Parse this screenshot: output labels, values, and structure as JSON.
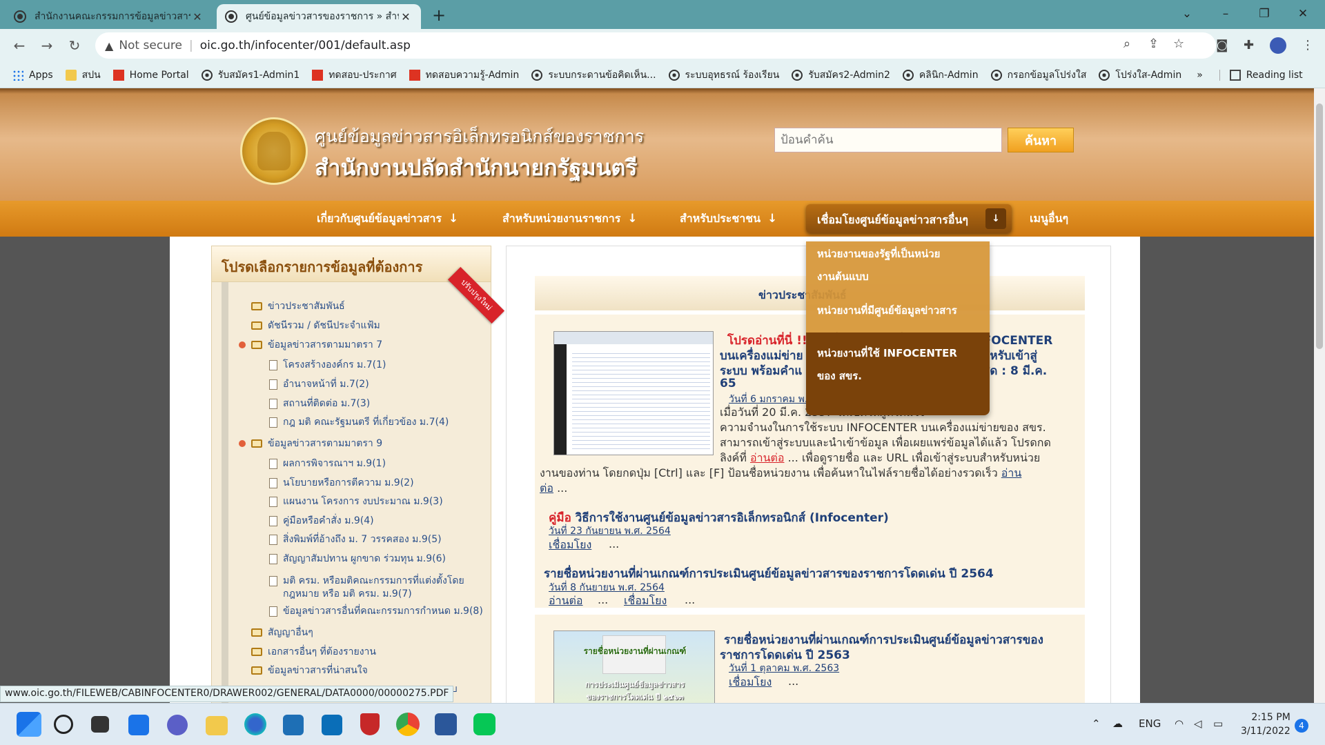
{
  "browser": {
    "tabs": [
      {
        "title": "สำนักงานคณะกรรมการข้อมูลข่าวสาร",
        "active": false
      },
      {
        "title": "ศูนย์ข้อมูลข่าวสารของราชการ » สำนัก",
        "active": true
      }
    ],
    "security_label": "Not secure",
    "url": "oic.go.th/infocenter/001/default.asp",
    "bookmarks": [
      {
        "label": "Apps",
        "icon": "grid-icon"
      },
      {
        "label": "สปน",
        "icon": "folder-icon"
      },
      {
        "label": "Home Portal",
        "icon": "red-icon"
      },
      {
        "label": "รับสมัคร1-Admin1",
        "icon": "globe-icon"
      },
      {
        "label": "ทดสอบ-ประกาศ",
        "icon": "red-icon"
      },
      {
        "label": "ทดสอบความรู้-Admin",
        "icon": "red-icon"
      },
      {
        "label": "ระบบกระดานข้อคิดเห็น...",
        "icon": "globe-icon"
      },
      {
        "label": "ระบบอุทธรณ์ ร้องเรียน",
        "icon": "globe-icon"
      },
      {
        "label": "รับสมัคร2-Admin2",
        "icon": "globe-icon"
      },
      {
        "label": "คลินิก-Admin",
        "icon": "globe-icon"
      },
      {
        "label": "กรอกข้อมูลโปร่งใส",
        "icon": "globe-icon"
      },
      {
        "label": "โปร่งใส-Admin",
        "icon": "globe-icon"
      }
    ],
    "bookmarks_more": "»",
    "reading_list": "Reading list",
    "status_url": "www.oic.go.th/FILEWEB/CABINFOCENTER0/DRAWER002/GENERAL/DATA0000/00000275.PDF"
  },
  "site": {
    "title_line1": "ศูนย์ข้อมูลข่าวสารอิเล็กทรอนิกส์ของราชการ",
    "title_line2": "สำนักงานปลัดสำนักนายกรัฐมนตรี",
    "search_placeholder": "ป้อนคำค้น",
    "search_button": "ค้นหา",
    "nav": [
      "เกี่ยวกับศูนย์ข้อมูลข่าวสาร",
      "สำหรับหน่วยงานราชการ",
      "สำหรับประชาชน",
      "เชื่อมโยงศูนย์ข้อมูลข่าวสารอื่นๆ",
      "เมนูอื่นๆ"
    ],
    "nav_arrow": "↓",
    "dropdown": [
      "หน่วยงานของรัฐที่เป็นหน่วย",
      "งานต้นแบบ",
      "หน่วยงานที่มีศูนย์ข้อมูลข่าวสาร",
      "หน่วยงานที่ใช้ INFOCENTER",
      "ของ สขร."
    ]
  },
  "left_panel": {
    "heading": "โปรดเลือกรายการข้อมูลที่ต้องการ",
    "ribbon": "ปรับปรุงใหม่",
    "items": [
      "ข่าวประชาสัมพันธ์",
      "ดัชนีรวม / ดัชนีประจำแฟ้ม",
      "ข้อมูลข่าวสารตามมาตรา 7",
      "โครงสร้างองค์กร ม.7(1)",
      "อำนาจหน้าที่ ม.7(2)",
      "สถานที่ติดต่อ ม.7(3)",
      "กฎ มติ คณะรัฐมนตรี ที่เกี่ยวข้อง ม.7(4)",
      "ข้อมูลข่าวสารตามมาตรา 9",
      "ผลการพิจารณาฯ ม.9(1)",
      "นโยบายหรือการตีความ ม.9(2)",
      "แผนงาน โครงการ งบประมาณ ม.9(3)",
      "คู่มือหรือคำสั่ง ม.9(4)",
      "สิ่งพิมพ์ที่อ้างถึง ม. 7 วรรคสอง ม.9(5)",
      "สัญญาสัมปทาน ผูกขาด ร่วมทุน ม.9(6)",
      "มติ ครม. หรือมติคณะกรรมการที่แต่งตั้งโดย",
      "กฎหมาย หรือ มติ ครม. ม.9(7)",
      "ข้อมูลข่าวสารอื่นที่คณะกรรมการกำหนด ม.9(8)",
      "สัญญาอื่นๆ",
      "เอกสารอื่นๆ ที่ต้องรายงาน",
      "ข้อมูลข่าวสารที่น่าสนใจ",
      "ม-ตอบ"
    ]
  },
  "news": {
    "heading": "ข่าวประชาสัมพันธ์",
    "item1": {
      "title_red": "โปรดอ่านที่นี่ !!",
      "title_line1": "รายชื่อหน่วยงานที่ใช้งานระบบ INFOCENTER",
      "title_line2": "บนเครื่องแม่ข่าย",
      "title_line2b": "ที่อยู่ (URL) สำหรับเข้าสู่",
      "title_line3": "ระบบ พร้อมคำแ",
      "title_line3b": "ล่าสุด : 8 มี.ค.",
      "title_line4": "65",
      "date": "วันที่ 6 มกราคม พ.",
      "body1": "เมื่อวันที่ 20 มี.ค. 2557 ได้เปิดให้ผู้ที่ได้แจ้ง",
      "body2": "ความจำนงในการใช้ระบบ INFOCENTER บนเครื่องแม่ข่ายของ สขร.",
      "body3": "สามารถเข้าสู่ระบบและนำเข้าข้อมูล เพื่อเผยแพร่ข้อมูลได้แล้ว โปรดกด",
      "body4a": "ลิงค์ที่",
      "body4link": "อ่านต่อ",
      "body4b": "... เพื่อดูรายชื่อ และ URL เพื่อเข้าสู่ระบบสำหรับหน่วย",
      "body5": "งานของท่าน โดยกดปุ่ม [Ctrl] และ [F] ป้อนชื่อหน่วยงาน เพื่อค้นหาในไฟล์รายชื่อได้อย่างรวดเร็ว",
      "body5link": "อ่าน",
      "body6link": "ต่อ",
      "ellipsis": "..."
    },
    "item2": {
      "title_red": "คู่มือ",
      "title": "วิธีการใช้งานศูนย์ข้อมูลข่าวสารอิเล็กทรอนิกส์ (Infocenter)",
      "date": "วันที่ 23 กันยายน พ.ศ. 2564",
      "link": "เชื่อมโยง",
      "ellipsis": "..."
    },
    "item3": {
      "title": "รายชื่อหน่วยงานที่ผ่านเกณฑ์การประเมินศูนย์ข้อมูลข่าวสารของราชการโดดเด่น ปี 2564",
      "date": "วันที่ 8 กันยายน พ.ศ. 2564",
      "link1": "อ่านต่อ",
      "link2": "เชื่อมโยง",
      "ellipsis": "..."
    },
    "item4": {
      "title_line1": "รายชื่อหน่วยงานที่ผ่านเกณฑ์การประเมินศูนย์ข้อมูลข่าวสารของ",
      "title_line2": "ราชการโดดเด่น ปี 2563",
      "date": "วันที่ 1 ตุลาคม พ.ศ. 2563",
      "link": "เชื่อมโยง",
      "ellipsis": "...",
      "thumb_text1": "รายชื่อหน่วยงานที่ผ่านเกณฑ์",
      "thumb_text2": "การประเมินศูนย์ข้อมูลข่าวสาร",
      "thumb_text3": "ของราชการโดดเด่น ปี ๒๕๖๓"
    }
  },
  "taskbar": {
    "lang": "ENG",
    "time": "2:15 PM",
    "date": "3/11/2022",
    "notifications": "4"
  }
}
